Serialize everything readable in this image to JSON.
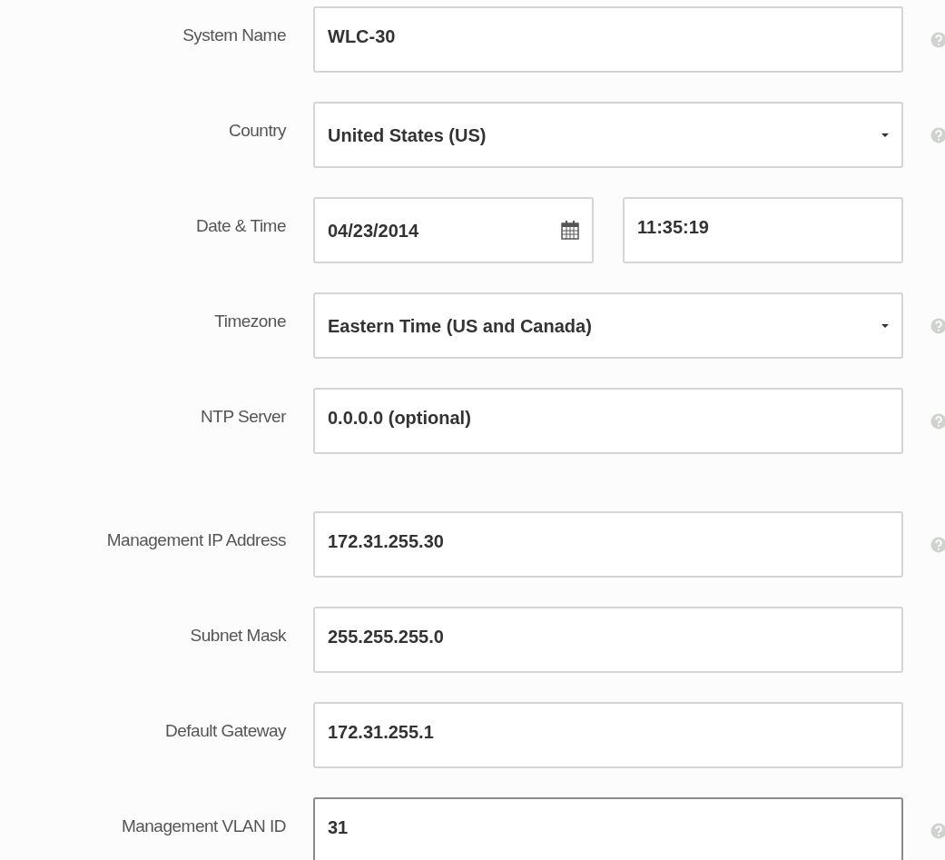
{
  "sections": [
    {
      "fields": [
        {
          "label": "System Name",
          "kind": "text",
          "value": "WLC-30",
          "help": true,
          "focused": false
        },
        {
          "label": "Country",
          "kind": "select",
          "value": "United States (US)",
          "help": true,
          "focused": false
        },
        {
          "label": "Date & Time",
          "kind": "datetime",
          "date": "04/23/2014",
          "time": "11:35:19",
          "help": false,
          "focused": false
        },
        {
          "label": "Timezone",
          "kind": "select",
          "value": "Eastern Time (US and Canada)",
          "help": true,
          "focused": false
        },
        {
          "label": "NTP Server",
          "kind": "text",
          "value": "0.0.0.0 (optional)",
          "help": true,
          "focused": false
        }
      ]
    },
    {
      "fields": [
        {
          "label": "Management IP Address",
          "kind": "text",
          "value": "172.31.255.30",
          "help": true,
          "focused": false
        },
        {
          "label": "Subnet Mask",
          "kind": "text",
          "value": "255.255.255.0",
          "help": false,
          "focused": false
        },
        {
          "label": "Default Gateway",
          "kind": "text",
          "value": "172.31.255.1",
          "help": false,
          "focused": false
        },
        {
          "label": "Management VLAN ID",
          "kind": "text",
          "value": "31",
          "help": true,
          "focused": true
        }
      ]
    }
  ]
}
